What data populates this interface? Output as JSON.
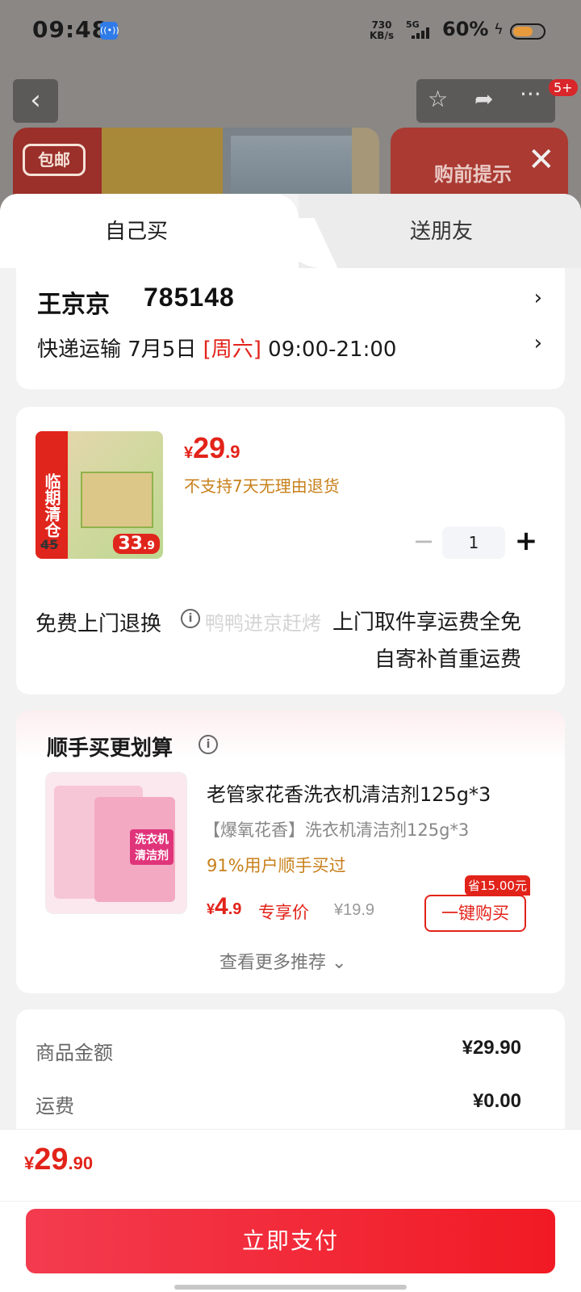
{
  "status_bar": {
    "time": "09:48",
    "nfc_icon": "nfc-icon",
    "speed_top": "730",
    "speed_unit": "KB/s",
    "network": "5G",
    "battery_pct": "60%"
  },
  "top_nav": {
    "badge": "5+",
    "baoyou_label": "包邮",
    "pre_purchase_tip": "购前提示"
  },
  "tabs": {
    "self_buy": "自己买",
    "gift_friend": "送朋友"
  },
  "address": {
    "name": "王京京",
    "code": "785148",
    "delivery_prefix": "快递运输 7月5日 ",
    "delivery_weekday": "[周六]",
    "delivery_time": " 09:00-21:00"
  },
  "product": {
    "image_band": "临期清仓",
    "image_old_price": "45",
    "image_new_price_int": "33",
    "image_new_price_dec": ".9",
    "price_currency": "¥",
    "price_int": "29",
    "price_dec": ".9",
    "no_return_notice": "不支持7天无理由退货",
    "quantity": "1",
    "free_return_label": "免费上门退换",
    "watermark": "鸭鸭进京赶烤",
    "return_line1": "上门取件享运费全免",
    "return_line2": "自寄补首重运费"
  },
  "recommend": {
    "title": "顺手买更划算",
    "image_label": "洗衣机清洁剂",
    "item_name": "老管家花香洗衣机清洁剂125g*3",
    "item_sub": "【爆氧花香】洗衣机清洁剂125g*3",
    "buy_rate": "91%用户顺手买过",
    "price_currency": "¥",
    "price_int": "4",
    "price_dec": ".9",
    "exclusive_label": "专享价",
    "original_price": "¥19.9",
    "save_tag": "省15.00元",
    "buy_button": "一键购买",
    "more_label": "查看更多推荐 ⌄"
  },
  "summary": {
    "rows": [
      {
        "label": "商品金额",
        "value": "¥29.90"
      },
      {
        "label": "运费",
        "value": "¥0.00"
      }
    ]
  },
  "footer": {
    "total_currency": "¥",
    "total_int": "29",
    "total_dec": ".90",
    "pay_button": "立即支付"
  }
}
